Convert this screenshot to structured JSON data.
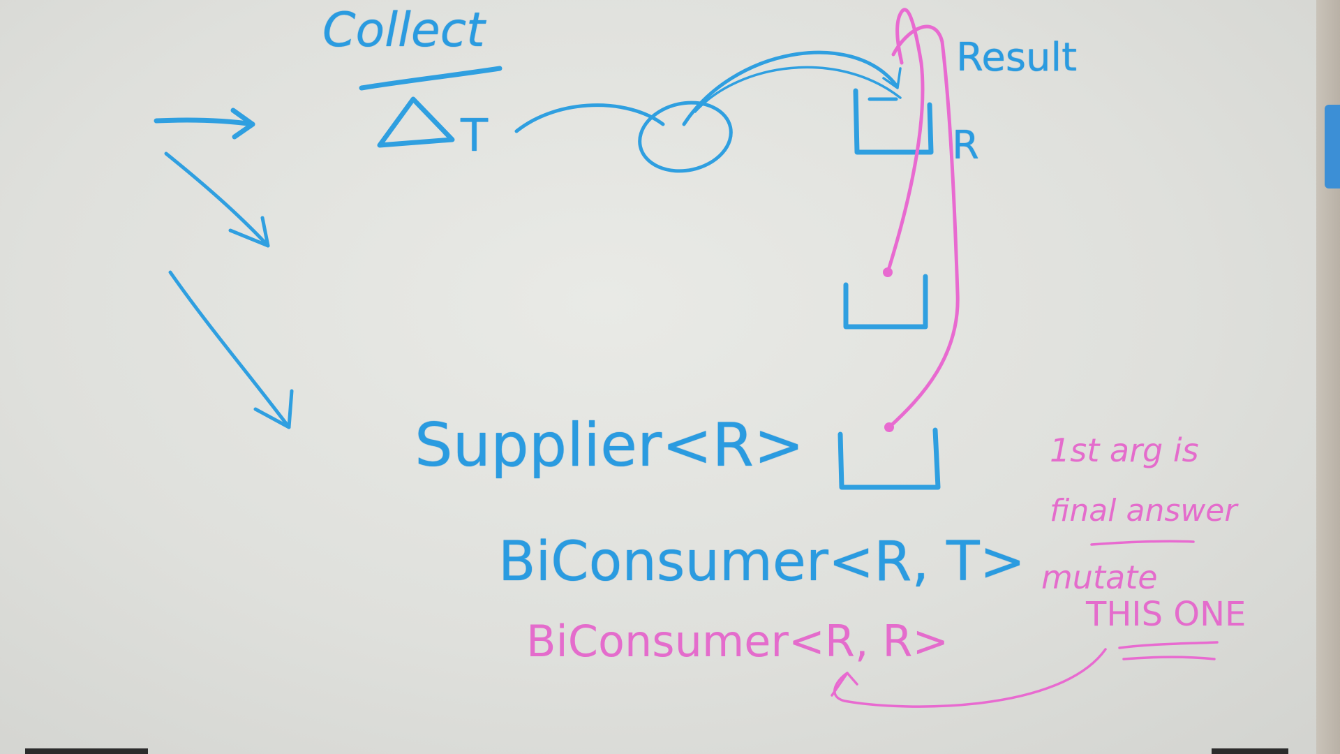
{
  "board": {
    "collect": "Collect",
    "triangle": "Δ",
    "type_t": "T",
    "result": "Result",
    "type_r": "R",
    "supplier": "Supplier<R>",
    "biconsumer_rt": "BiConsumer<R, T>",
    "biconsumer_rr": "BiConsumer<R, R>",
    "note_line1": "1st arg is",
    "note_line2": "final answer",
    "note_line3": "mutate",
    "note_line4": "THIS ONE"
  },
  "colors": {
    "blue_marker": "#2f9fe0",
    "pink_marker": "#e86ad0",
    "board": "#e3e4e0"
  }
}
